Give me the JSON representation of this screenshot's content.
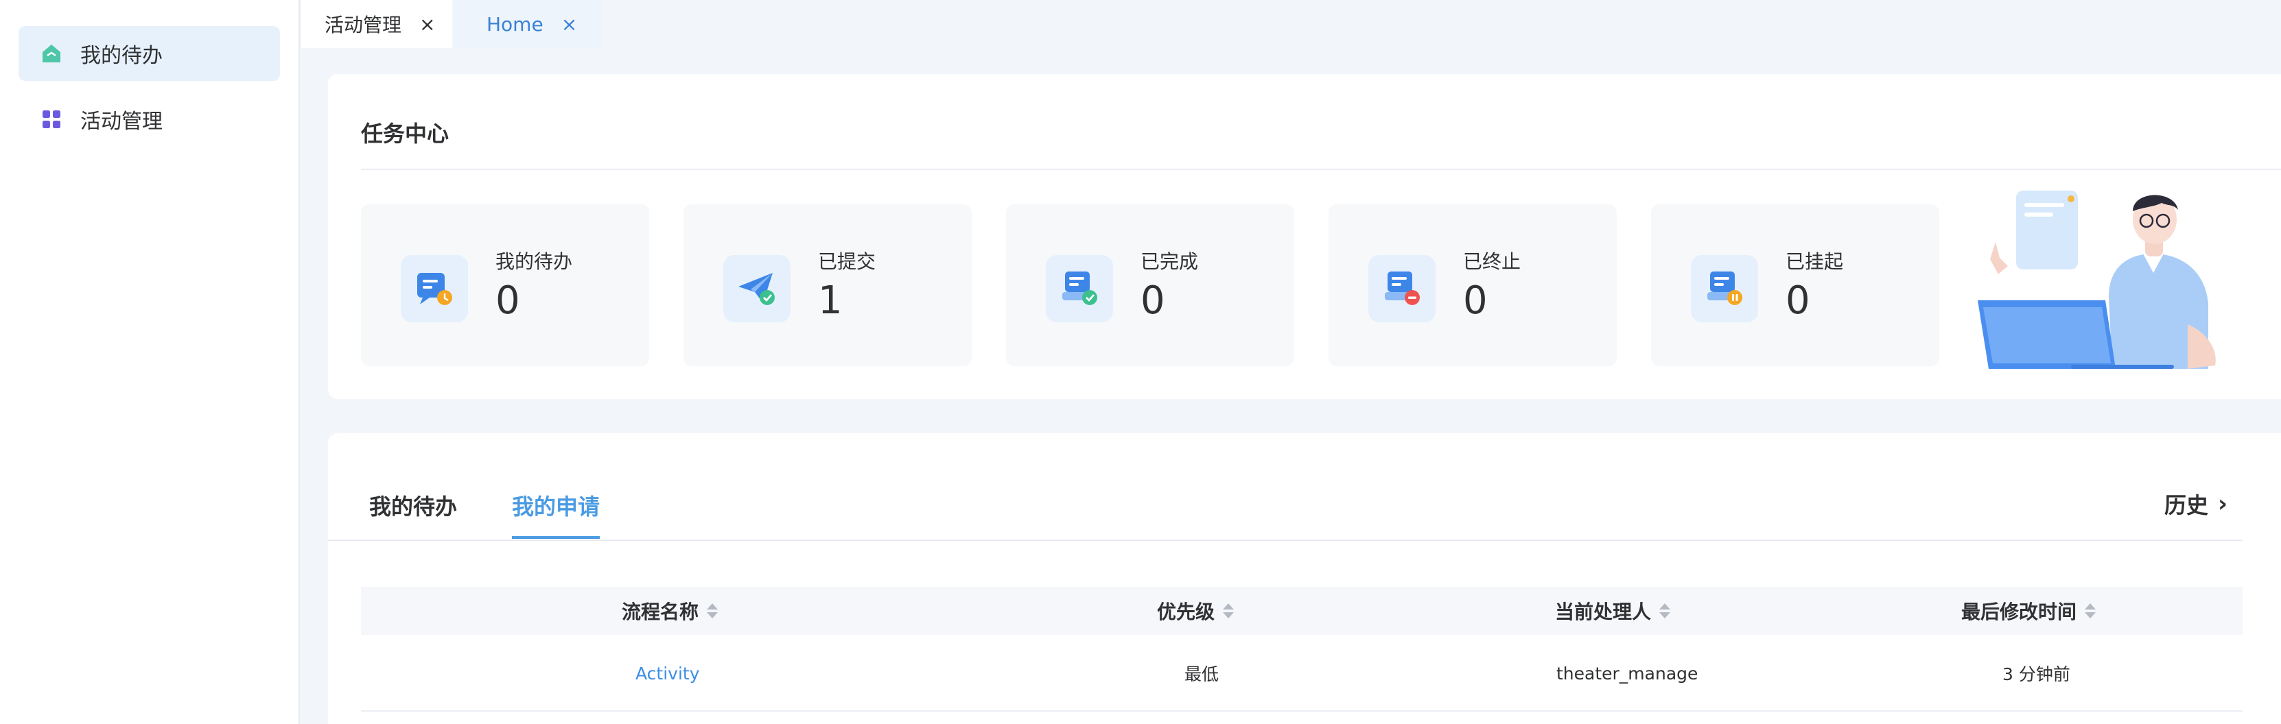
{
  "sidebar": {
    "items": [
      {
        "label": "我的待办",
        "icon": "home-icon",
        "active": true
      },
      {
        "label": "活动管理",
        "icon": "grid-icon",
        "active": false
      }
    ]
  },
  "tabs": [
    {
      "label": "活动管理",
      "close": "×"
    },
    {
      "label": "Home",
      "close": "×"
    }
  ],
  "task_center": {
    "title": "任务中心",
    "stats": [
      {
        "label": "我的待办",
        "value": "0",
        "icon": "todo-clock-icon",
        "badge_color": "#f5a623"
      },
      {
        "label": "已提交",
        "value": "1",
        "icon": "paper-plane-check-icon",
        "badge_color": "#3cc08e"
      },
      {
        "label": "已完成",
        "value": "0",
        "icon": "document-check-icon",
        "badge_color": "#3cc08e"
      },
      {
        "label": "已终止",
        "value": "0",
        "icon": "document-stop-icon",
        "badge_color": "#ef5350"
      },
      {
        "label": "已挂起",
        "value": "0",
        "icon": "document-pause-icon",
        "badge_color": "#f5a623"
      }
    ],
    "illustration": "person-with-laptop-illustration"
  },
  "requests": {
    "tabs": [
      "我的待办",
      "我的申请"
    ],
    "active_tab": 1,
    "history_label": "历史",
    "columns": [
      "流程名称",
      "优先级",
      "当前处理人",
      "最后修改时间"
    ],
    "rows": [
      [
        "Activity",
        "最低",
        "theater_manage",
        "3 分钟前"
      ]
    ]
  },
  "colors": {
    "accent": "#3a82d6",
    "active_tab": "#4a9be2",
    "sidebar_active_bg": "#e6f1fc",
    "page_bg": "#f2f5f9"
  }
}
